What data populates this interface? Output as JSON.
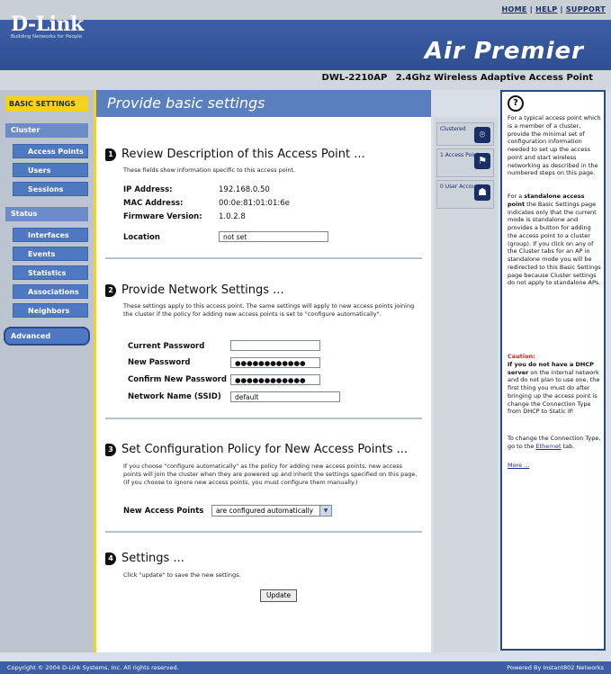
{
  "top_links": {
    "home": "HOME",
    "help": "HELP",
    "support": "SUPPORT",
    "sep": "|"
  },
  "header": {
    "logo": "D-Link",
    "tagline": "Building Networks for People",
    "brand": "Air Premier",
    "model": "DWL-2210AP",
    "product": "2.4Ghz Wireless Adaptive Access Point"
  },
  "nav": {
    "basic": "BASIC SETTINGS",
    "cluster": "Cluster",
    "cluster_items": [
      "Access Points",
      "Users",
      "Sessions"
    ],
    "status": "Status",
    "status_items": [
      "Interfaces",
      "Events",
      "Statistics",
      "Associations",
      "Neighbors"
    ],
    "advanced": "Advanced"
  },
  "page": {
    "title": "Provide basic settings",
    "s1": {
      "num": "1",
      "heading": "Review Description of this Access Point ...",
      "desc": "These fields show information specific to this access point.",
      "ip_label": "IP Address:",
      "ip": "192.168.0.50",
      "mac_label": "MAC Address:",
      "mac": "00:0e:81:01:01:6e",
      "fw_label": "Firmware Version:",
      "fw": "1.0.2.8",
      "loc_label": "Location",
      "loc": "not set"
    },
    "s2": {
      "num": "2",
      "heading": "Provide Network Settings ...",
      "desc": "These settings apply to this access point. The same settings will apply to new access points joining the cluster if the policy for adding new access points is set to \"configure automatically\".",
      "cur_pw_label": "Current Password",
      "new_pw_label": "New Password",
      "new_pw": "●●●●●●●●●●●●",
      "conf_pw_label": "Confirm New Password",
      "conf_pw": "●●●●●●●●●●●●",
      "ssid_label": "Network Name (SSID)",
      "ssid": "default"
    },
    "s3": {
      "num": "3",
      "heading": "Set Configuration Policy for New Access Points ...",
      "desc": "If you choose \"configure automatically\" as the policy for adding new access points, new access points will join the cluster when they are powered up and inherit the settings specified on this page. (If you choose to ignore new access points, you must configure them manually.)",
      "nap_label": "New Access Points",
      "nap_value": "are configured automatically"
    },
    "s4": {
      "num": "4",
      "heading": "Settings ...",
      "desc": "Click \"update\" to save the new settings.",
      "update": "Update"
    }
  },
  "tabs": {
    "clustered": "Clustered",
    "ap": "1 Access Point",
    "users": "0 User Accounts"
  },
  "help": {
    "p1": "For a typical access point which is a member of a cluster, provide the minimal set of configuration information needed to set up the access point and start wireless networking as described in the numbered steps on this page.",
    "p2a": "For a ",
    "p2b": "standalone access point",
    "p2c": " the Basic Settings page indicates only that the current mode is standalone and provides a button for adding the access point to a cluster (group). If you click on any of the Cluster tabs for an AP in standalone mode you will be redirected to this Basic Settings page because Cluster settings do not apply to standalone APs.",
    "caution": "Caution:",
    "p3b": "If you do not have a DHCP server",
    "p3c": " on the internal network and do not plan to use one, the first thing you must do after bringing up the access point is change the Connection Type from DHCP to Static IP.",
    "p4a": "To change the Connection Type, go to the ",
    "p4link": "Ethernet",
    "p4b": " tab.",
    "more": "More ..."
  },
  "footer": {
    "left": "Copyright © 2004 D-Link Systems, Inc. All rights reserved.",
    "right": "Powered By Instant802 Networks"
  },
  "colors": {
    "header_blue": "#3d5ea6",
    "nav_yellow": "#f7d21d",
    "nav_item_blue": "#4f78c2",
    "help_border": "#2c4a8a"
  },
  "icons": {
    "help": "question-mark-circle-icon",
    "clustered": "network-icon",
    "ap": "access-point-icon",
    "users": "users-icon"
  }
}
